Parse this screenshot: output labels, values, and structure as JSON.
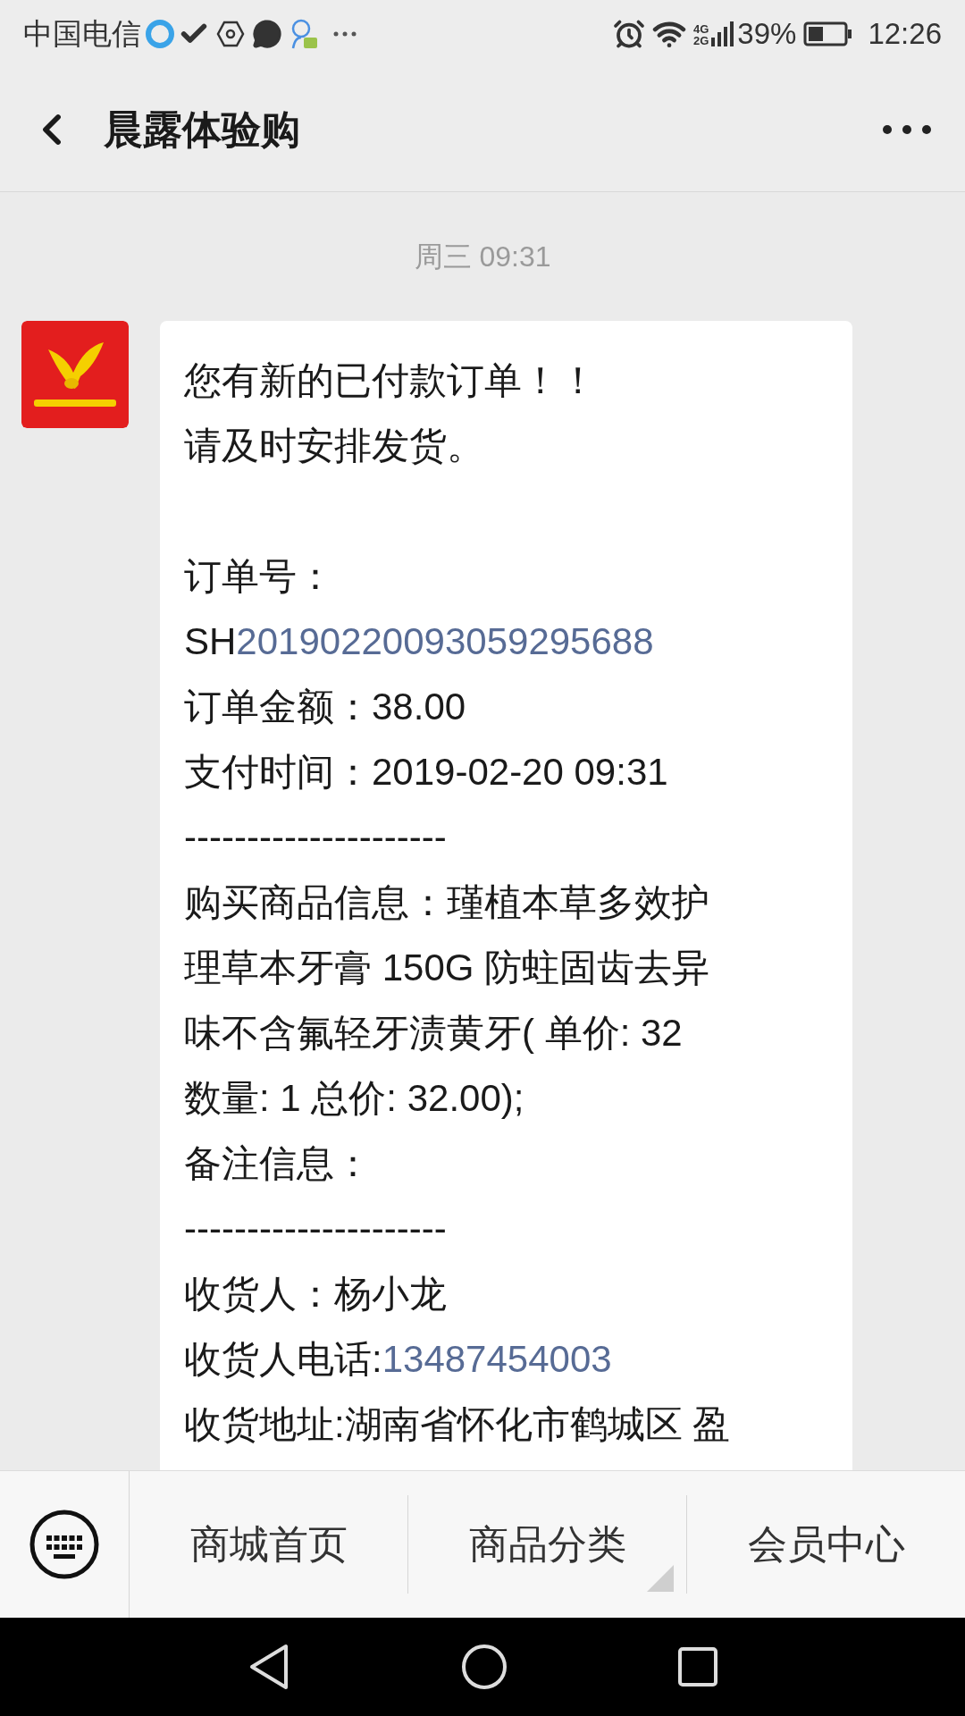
{
  "status_bar": {
    "carrier": "中国电信",
    "network_top": "4G",
    "network_bottom": "2G",
    "battery": "39%",
    "time": "12:26"
  },
  "header": {
    "title": "晨露体验购"
  },
  "chat": {
    "timestamp": "周三 09:31",
    "message": {
      "lines": [
        {
          "kind": "text",
          "text": "您有新的已付款订单！！"
        },
        {
          "kind": "text",
          "text": "请及时安排发货。"
        },
        {
          "kind": "gap"
        },
        {
          "kind": "text",
          "text": "订单号："
        },
        {
          "kind": "link",
          "text": "SH",
          "link": "20190220093059295688"
        },
        {
          "kind": "text",
          "text": "订单金额：38.00"
        },
        {
          "kind": "text",
          "text": "支付时间：2019-02-20 09:31"
        },
        {
          "kind": "text",
          "text": "---------------------"
        },
        {
          "kind": "text",
          "text": "购买商品信息：瑾植本草多效护"
        },
        {
          "kind": "text",
          "text": "理草本牙膏 150G 防蛀固齿去异"
        },
        {
          "kind": "text",
          "text": "味不含氟轻牙渍黄牙(  单价: 32"
        },
        {
          "kind": "text",
          "text": "数量: 1 总价: 32.00);"
        },
        {
          "kind": "text",
          "text": "备注信息："
        },
        {
          "kind": "text",
          "text": "---------------------"
        },
        {
          "kind": "text",
          "text": "收货人：杨小龙"
        },
        {
          "kind": "link",
          "text": "收货人电话:",
          "link": "13487454003"
        },
        {
          "kind": "text",
          "text": "收货地址:湖南省怀化市鹤城区 盈"
        }
      ]
    }
  },
  "menu_bar": {
    "items": [
      {
        "label": "商城首页",
        "submenu": false
      },
      {
        "label": "商品分类",
        "submenu": true
      },
      {
        "label": "会员中心",
        "submenu": false
      }
    ]
  }
}
